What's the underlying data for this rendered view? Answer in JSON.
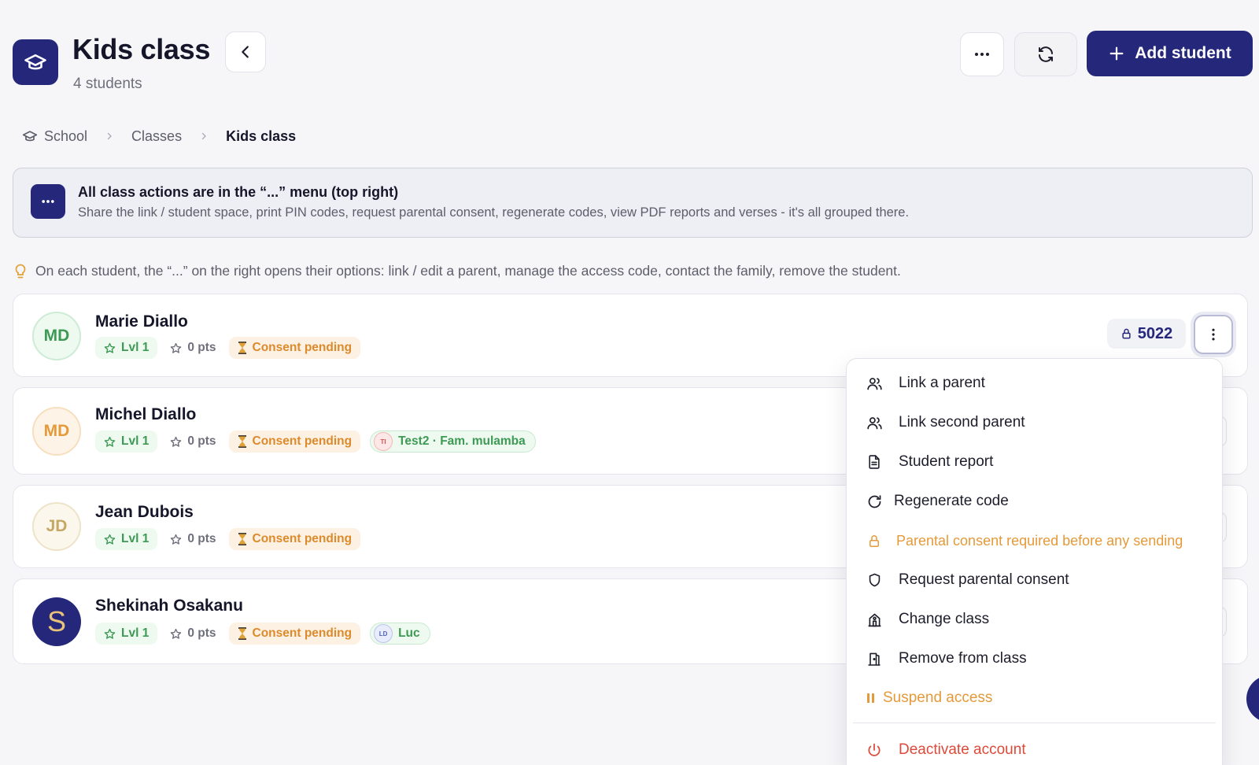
{
  "header": {
    "title": "Kids class",
    "subtitle": "4 students",
    "add_button_label": "Add student"
  },
  "breadcrumb": [
    {
      "label": "School"
    },
    {
      "label": "Classes"
    },
    {
      "label": "Kids class"
    }
  ],
  "banner": {
    "title": "All class actions are in the “...” menu (top right)",
    "text": "Share the link / student space, print PIN codes, request parental consent, regenerate codes, view PDF reports and verses - it's all grouped there."
  },
  "tip": "On each student, the “...” on the right opens their options: link / edit a parent, manage the access code, contact the family, remove the student.",
  "students": [
    {
      "initials": "MD",
      "name": "Marie Diallo",
      "level": "Lvl 1",
      "points": "0 pts",
      "consent": "Consent pending",
      "code": "5022"
    },
    {
      "initials": "MD",
      "name": "Michel Diallo",
      "level": "Lvl 1",
      "points": "0 pts",
      "consent": "Consent pending",
      "parent_initials": "TI",
      "parent": "Test2 · Fam. mulamba"
    },
    {
      "initials": "JD",
      "name": "Jean Dubois",
      "level": "Lvl 1",
      "points": "0 pts",
      "consent": "Consent pending"
    },
    {
      "initials": "S",
      "name": "Shekinah Osakanu",
      "level": "Lvl 1",
      "points": "0 pts",
      "consent": "Consent pending",
      "parent_initials": "LD",
      "parent": "Luc"
    }
  ],
  "menu": {
    "items": [
      {
        "label": "Link a parent",
        "icon": "users-icon"
      },
      {
        "label": "Link second parent",
        "icon": "users-icon"
      },
      {
        "label": "Student report",
        "icon": "file-text-icon"
      },
      {
        "label": "Regenerate code",
        "icon": "refresh-icon"
      },
      {
        "label": "Parental consent required before any sending",
        "icon": "lock-icon"
      },
      {
        "label": "Request parental consent",
        "icon": "shield-icon"
      },
      {
        "label": "Change class",
        "icon": "school-icon"
      },
      {
        "label": "Remove from class",
        "icon": "door-icon"
      },
      {
        "label": "Suspend access",
        "icon": "pause-icon"
      },
      {
        "label": "Deactivate account",
        "icon": "power-icon"
      }
    ]
  },
  "colors": {
    "primary": "#25287a",
    "success": "#3d9a54",
    "warning": "#dc8a2b",
    "danger": "#dc4a3a"
  }
}
